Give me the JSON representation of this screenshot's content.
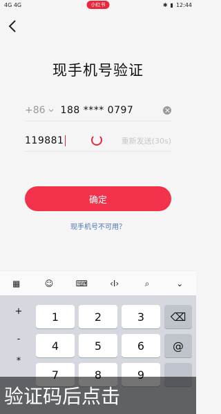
{
  "statusbar": {
    "left_text": "4G 4G",
    "badge": "小红书",
    "time": "12:44"
  },
  "page": {
    "title": "现手机号验证",
    "country_code": "+86",
    "phone": "188 **** 0797",
    "code_value": "119881",
    "resend": "重新发送(30s)",
    "confirm": "确定",
    "unavailable": "现手机号不可用？"
  },
  "toolbar": {
    "icons": [
      "grid-icon",
      "emoji-icon",
      "keyboard-icon",
      "cursor-move-icon",
      "search-icon",
      "collapse-icon"
    ]
  },
  "keyboard": {
    "symbols": [
      "+",
      "-",
      "*"
    ],
    "keys": [
      "1",
      "2",
      "3",
      "4",
      "5",
      "6",
      "7",
      "8",
      "9"
    ],
    "at": "@"
  },
  "watermark": {
    "text": "验证码后点击"
  },
  "colors": {
    "accent": "#f2324a",
    "link": "#4a74b7"
  }
}
